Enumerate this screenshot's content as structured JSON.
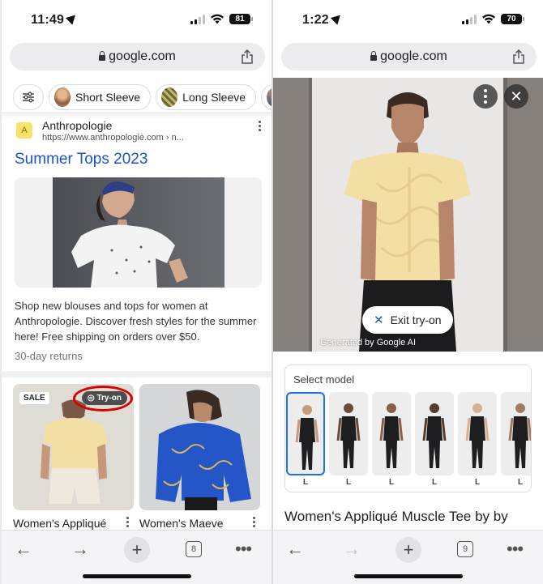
{
  "left": {
    "status": {
      "time": "11:49",
      "battery": "81"
    },
    "url": "google.com",
    "chips": [
      {
        "label": "Short Sleeve"
      },
      {
        "label": "Long Sleeve"
      }
    ],
    "result": {
      "site": "Anthropologie",
      "url": "https://www.anthropologie.com › n...",
      "favicon": "A",
      "title": "Summer Tops 2023",
      "snippet": "Shop new blouses and tops for women at Anthropologie. Discover fresh styles for the summer here! Free shipping on orders over $50.",
      "returns": "30-day returns"
    },
    "products": [
      {
        "name": "Women's Appliqué",
        "badge": "SALE",
        "tryon": "Try-on"
      },
      {
        "name": "Women's Maeve"
      }
    ],
    "toolbar": {
      "tabs": "8"
    }
  },
  "right": {
    "status": {
      "time": "1:22",
      "battery": "70"
    },
    "url": "google.com",
    "viewer": {
      "exit_label": "Exit try-on",
      "generated": "Generated by Google AI"
    },
    "model_select": {
      "label": "Select model",
      "sizes": [
        "L",
        "L",
        "L",
        "L",
        "L",
        "L"
      ]
    },
    "product_title": "Women's Appliqué Muscle Tee by by",
    "toolbar": {
      "tabs": "9"
    }
  },
  "colors": {
    "link": "#1a55c8",
    "highlight_ring": "#d90000",
    "selected_model": "#1a73e8",
    "tee": "#f3dfa3"
  },
  "icons": [
    "location-arrow-icon",
    "cellular-icon",
    "wifi-icon",
    "battery-icon",
    "lock-icon",
    "share-icon",
    "filter-icon",
    "kebab-icon",
    "camera-icon",
    "back-arrow-icon",
    "forward-arrow-icon",
    "plus-icon",
    "tabs-icon",
    "more-icon",
    "close-icon"
  ]
}
